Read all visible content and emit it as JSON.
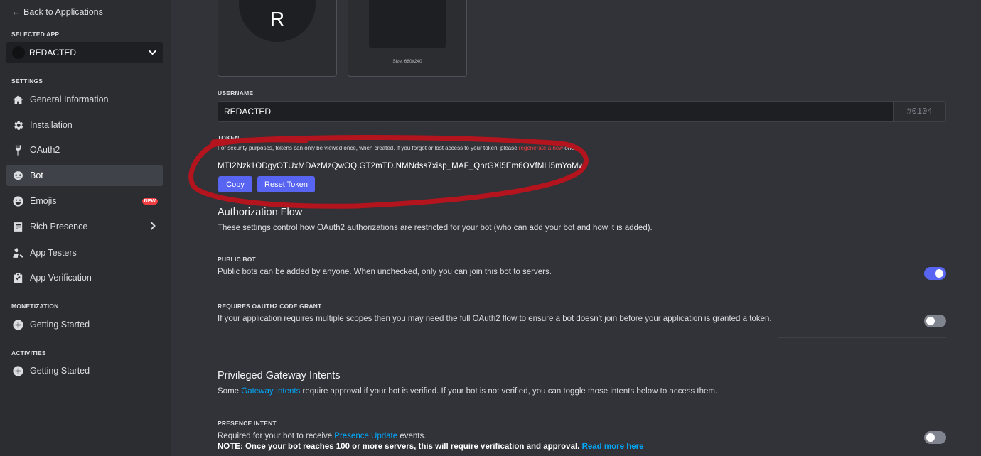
{
  "sidebar": {
    "back_label": "Back to Applications",
    "selected_app_label": "SELECTED APP",
    "app_name": "REDACTED",
    "settings_label": "SETTINGS",
    "items": [
      {
        "label": "General Information",
        "icon": "home-icon"
      },
      {
        "label": "Installation",
        "icon": "gear-icon"
      },
      {
        "label": "OAuth2",
        "icon": "wrench-icon"
      },
      {
        "label": "Bot",
        "icon": "bot-icon",
        "active": true
      },
      {
        "label": "Emojis",
        "icon": "smile-icon",
        "badge": "NEW"
      },
      {
        "label": "Rich Presence",
        "icon": "document-icon"
      },
      {
        "label": "App Testers",
        "icon": "person-icon"
      },
      {
        "label": "App Verification",
        "icon": "clipboard-check-icon"
      }
    ],
    "monetization_label": "MONETIZATION",
    "monetization_item": "Getting Started",
    "activities_label": "ACTIVITIES",
    "activities_item": "Getting Started"
  },
  "bot": {
    "avatar_letter": "R",
    "banner_size": "Size: 680x240",
    "username_label": "USERNAME",
    "username_value": "REDACTED",
    "discriminator": "#0104",
    "token_label": "TOKEN",
    "token_help_1": "For security purposes, tokens can only be viewed once, when created. If you forgot or lost access to your token, please ",
    "token_help_link": "regenerate a new",
    "token_help_2": " one.",
    "token_value": "MTI2Nzk1ODgyOTUxMDAzMzQwOQ.GT2mTD.NMNdss7xisp_MAF_QnrGXl5Em6OVfMLi5mYoMw",
    "copy_label": "Copy",
    "reset_label": "Reset Token"
  },
  "auth_flow": {
    "title": "Authorization Flow",
    "description": "These settings control how OAuth2 authorizations are restricted for your bot (who can add your bot and how it is added).",
    "public_bot_label": "PUBLIC BOT",
    "public_bot_desc": "Public bots can be added by anyone. When unchecked, only you can join this bot to servers.",
    "code_grant_label": "REQUIRES OAUTH2 CODE GRANT",
    "code_grant_desc": "If your application requires multiple scopes then you may need the full OAuth2 flow to ensure a bot doesn't join before your application is granted a token."
  },
  "intents": {
    "title": "Privileged Gateway Intents",
    "desc_1": "Some ",
    "desc_link": "Gateway Intents",
    "desc_2": " require approval if your bot is verified. If your bot is not verified, you can toggle those intents below to access them.",
    "presence_label": "PRESENCE INTENT",
    "presence_desc_1": "Required for your bot to receive ",
    "presence_desc_link": "Presence Update",
    "presence_desc_2": " events.",
    "presence_note": "NOTE: Once your bot reaches 100 or more servers, this will require verification and approval.",
    "presence_note_link": "Read more here"
  },
  "colors": {
    "accent": "#5865f2",
    "annotation": "#b3141d",
    "danger": "#f23f43",
    "link": "#00a8fc"
  }
}
